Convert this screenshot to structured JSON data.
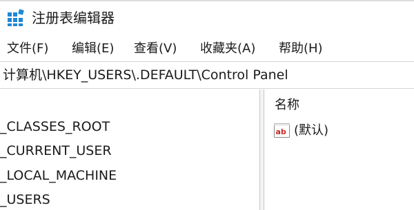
{
  "window": {
    "title": "注册表编辑器",
    "icon": "regedit-icon"
  },
  "menu": {
    "items": [
      {
        "label": "文件(F)"
      },
      {
        "label": "编辑(E)"
      },
      {
        "label": "查看(V)"
      },
      {
        "label": "收藏夹(A)"
      },
      {
        "label": "帮助(H)"
      }
    ]
  },
  "address": {
    "path": "计算机\\HKEY_USERS\\.DEFAULT\\Control Panel"
  },
  "tree": {
    "items": [
      {
        "label": "_CLASSES_ROOT"
      },
      {
        "label": "_CURRENT_USER"
      },
      {
        "label": "_LOCAL_MACHINE"
      },
      {
        "label": "_USERS"
      }
    ]
  },
  "list": {
    "column_name": "名称",
    "rows": [
      {
        "name": "(默认)",
        "icon": "string-value-icon"
      }
    ]
  },
  "colors": {
    "icon_blue": "#1e88d6",
    "icon_red": "#c62828"
  }
}
